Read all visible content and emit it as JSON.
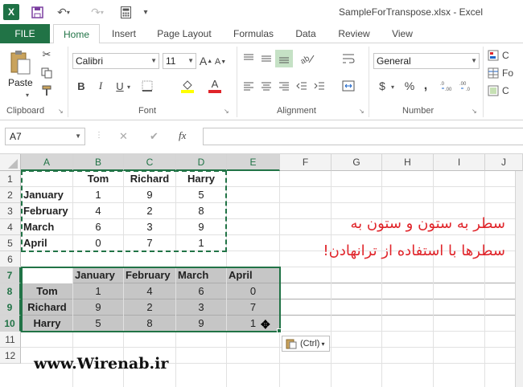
{
  "app": {
    "logo": "X",
    "window_title": "SampleForTranspose.xlsx - Excel"
  },
  "tabs": [
    "FILE",
    "Home",
    "Insert",
    "Page Layout",
    "Formulas",
    "Data",
    "Review",
    "View"
  ],
  "ribbon": {
    "paste_label": "Paste",
    "font_name": "Calibri",
    "font_size": "11",
    "grow_font": "A",
    "shrink_font": "A",
    "bold": "B",
    "italic": "I",
    "underline": "U",
    "font_color_glyph": "A",
    "number_format": "General",
    "currency": "$",
    "percent": "%",
    "comma": ",",
    "groups": {
      "clipboard": "Clipboard",
      "font": "Font",
      "alignment": "Alignment",
      "number": "Number"
    },
    "cut_off_labels": [
      "C",
      "Fo",
      "C"
    ]
  },
  "formula_bar": {
    "name_box": "A7",
    "fx": "fx",
    "cancel": "✕",
    "enter": "✔",
    "value": ""
  },
  "columns": [
    "A",
    "B",
    "C",
    "D",
    "E",
    "F",
    "G",
    "H",
    "I",
    "J"
  ],
  "rows": [
    "1",
    "2",
    "3",
    "4",
    "5",
    "6",
    "7",
    "8",
    "9",
    "10",
    "11",
    "12"
  ],
  "cells": {
    "B1": "Tom",
    "C1": "Richard",
    "D1": "Harry",
    "A2": "January",
    "B2": "1",
    "C2": "9",
    "D2": "5",
    "A3": "February",
    "B3": "4",
    "C3": "2",
    "D3": "8",
    "A4": "March",
    "B4": "6",
    "C4": "3",
    "D4": "9",
    "A5": "April",
    "B5": "0",
    "C5": "7",
    "D5": "1",
    "B7": "January",
    "C7": "February",
    "D7": "March",
    "E7": "April",
    "A8": "Tom",
    "B8": "1",
    "C8": "4",
    "D8": "6",
    "E8": "0",
    "A9": "Richard",
    "B9": "9",
    "C9": "2",
    "D9": "3",
    "E9": "7",
    "A10": "Harry",
    "B10": "5",
    "C10": "8",
    "D10": "9",
    "E10": "1"
  },
  "paste_options": "(Ctrl)",
  "annotation": {
    "line1": "سطر به ستون و ستون به",
    "line2": "سطرها با استفاده از ترانهادن!"
  },
  "watermark": "www.Wirenab.ir",
  "colors": {
    "excel_green": "#217346",
    "annotation_red": "#e0242a",
    "shade": "#c6c6c6"
  }
}
